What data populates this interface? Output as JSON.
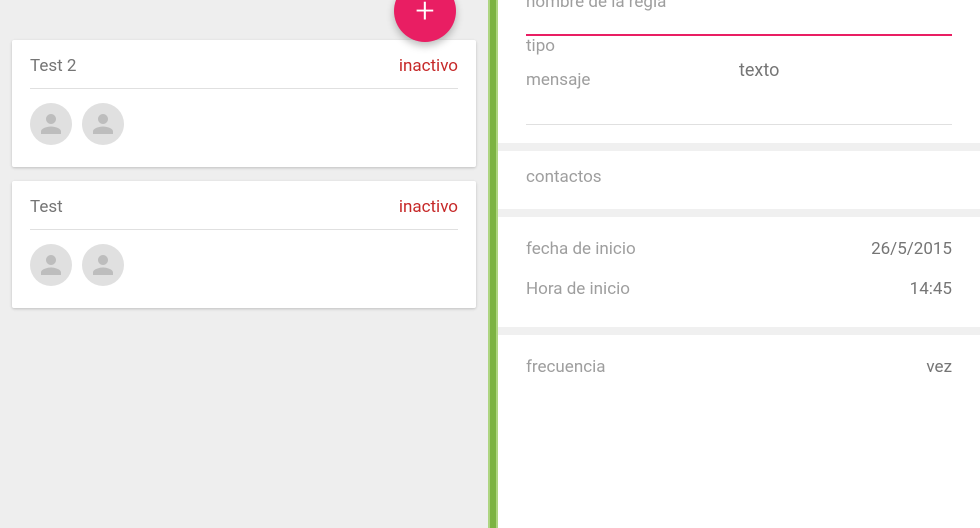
{
  "fab_label": "+",
  "rules": [
    {
      "title": "Test 2",
      "status": "inactivo"
    },
    {
      "title": "Test",
      "status": "inactivo"
    }
  ],
  "form": {
    "name_label": "nombre de la regla",
    "type_label": "tipo",
    "type_value": "texto",
    "message_label": "mensaje",
    "contacts_label": "contactos",
    "start_date_label": "fecha de inicio",
    "start_date_value": "26/5/2015",
    "start_time_label": "Hora de inicio",
    "start_time_value": "14:45",
    "frequency_label": "frecuencia",
    "frequency_value": "vez"
  }
}
